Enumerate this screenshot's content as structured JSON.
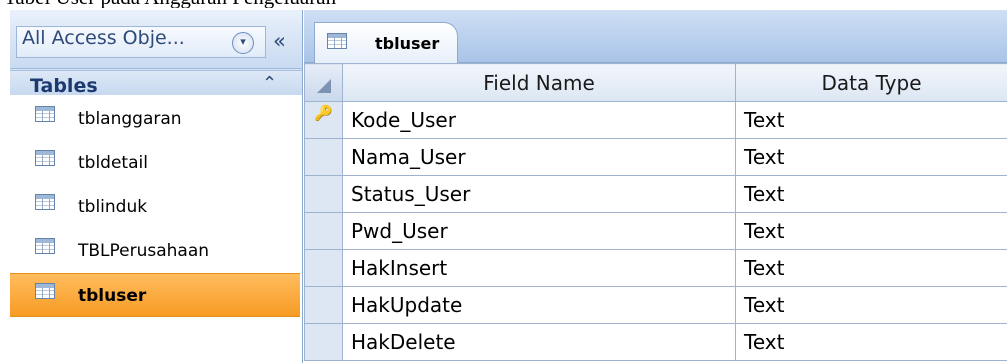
{
  "caption": "Tabel User pada Anggaran Pengeluaran",
  "nav": {
    "title": "All Access Obje...",
    "dropdown_icon": "▾",
    "collapse_icon": "«",
    "group": {
      "title": "Tables",
      "chevron": "⌃"
    },
    "items": [
      {
        "label": "tblanggaran"
      },
      {
        "label": "tbldetail"
      },
      {
        "label": "tblinduk"
      },
      {
        "label": "TBLPerusahaan"
      },
      {
        "label": "tbluser"
      }
    ]
  },
  "tab": {
    "label": "tbluser"
  },
  "grid": {
    "columns": {
      "field_name": "Field Name",
      "data_type": "Data Type"
    },
    "rows": [
      {
        "field": "Kode_User",
        "type": "Text",
        "primary_key": true
      },
      {
        "field": "Nama_User",
        "type": "Text"
      },
      {
        "field": "Status_User",
        "type": "Text"
      },
      {
        "field": "Pwd_User",
        "type": "Text"
      },
      {
        "field": "HakInsert",
        "type": "Text"
      },
      {
        "field": "HakUpdate",
        "type": "Text"
      },
      {
        "field": "HakDelete",
        "type": "Text"
      }
    ]
  },
  "colors": {
    "selected_item": "#f89b24",
    "nav_background": "#d6e3f3",
    "grid_border": "#9fb3cf"
  }
}
